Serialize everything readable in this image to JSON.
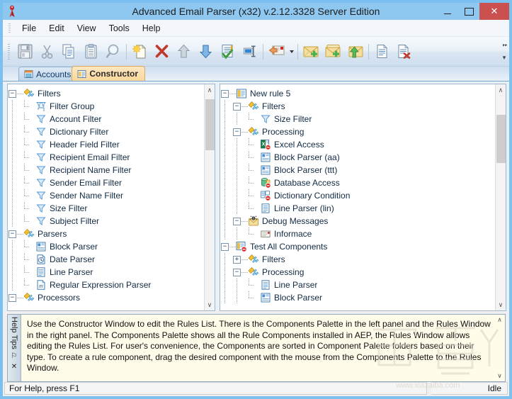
{
  "window": {
    "title": "Advanced Email Parser (x32) v.2.12.3328 Server Edition",
    "app_icon": "parser-app-icon",
    "minimize_label": "–",
    "maximize_label": "□",
    "close_label": "✕"
  },
  "menu": {
    "items": [
      {
        "label": "File"
      },
      {
        "label": "Edit"
      },
      {
        "label": "View"
      },
      {
        "label": "Tools"
      },
      {
        "label": "Help"
      }
    ]
  },
  "toolbar": {
    "buttons": [
      {
        "icon": "save-icon",
        "tooltip": "Save"
      },
      {
        "icon": "cut-icon",
        "tooltip": "Cut"
      },
      {
        "icon": "copy-icon",
        "tooltip": "Copy"
      },
      {
        "icon": "paste-icon",
        "tooltip": "Paste"
      },
      {
        "icon": "find-icon",
        "tooltip": "Find"
      },
      {
        "icon": "separator"
      },
      {
        "icon": "new-document-icon",
        "tooltip": "New"
      },
      {
        "icon": "delete-icon",
        "tooltip": "Delete"
      },
      {
        "icon": "move-up-icon",
        "tooltip": "Move Up"
      },
      {
        "icon": "move-down-icon",
        "tooltip": "Move Down"
      },
      {
        "icon": "test-document-icon",
        "tooltip": "Test"
      },
      {
        "icon": "rename-icon",
        "tooltip": "Rename"
      },
      {
        "icon": "separator"
      },
      {
        "icon": "reply-mail-icon",
        "tooltip": "Process Mail"
      },
      {
        "icon": "dropdown-caret"
      },
      {
        "icon": "separator"
      },
      {
        "icon": "add-mail-icon",
        "tooltip": "Add Message"
      },
      {
        "icon": "add-mail-folder-icon",
        "tooltip": "Add Messages Folder"
      },
      {
        "icon": "import-mail-icon",
        "tooltip": "Import Message"
      },
      {
        "icon": "separator"
      },
      {
        "icon": "document-icon",
        "tooltip": "View Log"
      },
      {
        "icon": "delete-document-icon",
        "tooltip": "Clear Log"
      }
    ],
    "overflow_label": "»"
  },
  "tabs": [
    {
      "label": "Accounts",
      "icon": "accounts-tab-icon",
      "active": false
    },
    {
      "label": "Constructor",
      "icon": "constructor-tab-icon",
      "active": true
    }
  ],
  "palette_tree": {
    "title": "Components Palette",
    "nodes": [
      {
        "depth": 0,
        "label": "Filters",
        "icon": "palette-folder-icon",
        "expander": "minus"
      },
      {
        "depth": 1,
        "label": "Filter Group",
        "icon": "filter-group-icon",
        "expander": "none"
      },
      {
        "depth": 1,
        "label": "Account Filter",
        "icon": "funnel-icon",
        "expander": "none"
      },
      {
        "depth": 1,
        "label": "Dictionary Filter",
        "icon": "funnel-icon",
        "expander": "none"
      },
      {
        "depth": 1,
        "label": "Header Field Filter",
        "icon": "funnel-icon",
        "expander": "none"
      },
      {
        "depth": 1,
        "label": "Recipient Email Filter",
        "icon": "funnel-icon",
        "expander": "none"
      },
      {
        "depth": 1,
        "label": "Recipient Name Filter",
        "icon": "funnel-icon",
        "expander": "none"
      },
      {
        "depth": 1,
        "label": "Sender Email Filter",
        "icon": "funnel-icon",
        "expander": "none"
      },
      {
        "depth": 1,
        "label": "Sender Name Filter",
        "icon": "funnel-icon",
        "expander": "none"
      },
      {
        "depth": 1,
        "label": "Size Filter",
        "icon": "funnel-icon",
        "expander": "none"
      },
      {
        "depth": 1,
        "label": "Subject Filter",
        "icon": "funnel-icon",
        "expander": "none"
      },
      {
        "depth": 0,
        "label": "Parsers",
        "icon": "palette-folder-icon",
        "expander": "minus"
      },
      {
        "depth": 1,
        "label": "Block Parser",
        "icon": "block-parser-icon",
        "expander": "none"
      },
      {
        "depth": 1,
        "label": "Date Parser",
        "icon": "date-parser-icon",
        "expander": "none"
      },
      {
        "depth": 1,
        "label": "Line Parser",
        "icon": "line-parser-icon",
        "expander": "none"
      },
      {
        "depth": 1,
        "label": "Regular Expression Parser",
        "icon": "regex-parser-icon",
        "expander": "none"
      },
      {
        "depth": 0,
        "label": "Processors",
        "icon": "palette-folder-icon",
        "expander": "minus"
      }
    ]
  },
  "rules_tree": {
    "title": "Rules Window",
    "nodes": [
      {
        "depth": 0,
        "label": "New rule 5",
        "icon": "rule-icon",
        "expander": "minus"
      },
      {
        "depth": 1,
        "label": "Filters",
        "icon": "palette-folder-icon",
        "expander": "minus"
      },
      {
        "depth": 2,
        "label": "Size Filter",
        "icon": "funnel-icon",
        "expander": "none"
      },
      {
        "depth": 1,
        "label": "Processing",
        "icon": "palette-folder-icon",
        "expander": "minus"
      },
      {
        "depth": 2,
        "label": "Excel Access",
        "icon": "excel-access-icon",
        "expander": "none"
      },
      {
        "depth": 2,
        "label": "Block Parser (aa)",
        "icon": "block-parser-icon",
        "expander": "none"
      },
      {
        "depth": 2,
        "label": "Block Parser (ttt)",
        "icon": "block-parser-icon",
        "expander": "none"
      },
      {
        "depth": 2,
        "label": "Database Access",
        "icon": "database-access-icon",
        "expander": "none"
      },
      {
        "depth": 2,
        "label": "Dictionary Condition",
        "icon": "dictionary-condition-icon",
        "expander": "none"
      },
      {
        "depth": 2,
        "label": "Line Parser (lin)",
        "icon": "line-parser-icon",
        "expander": "none"
      },
      {
        "depth": 1,
        "label": "Debug Messages",
        "icon": "debug-messages-icon",
        "expander": "minus"
      },
      {
        "depth": 2,
        "label": "Informace",
        "icon": "message-icon",
        "expander": "none"
      },
      {
        "depth": 0,
        "label": "Test All Components",
        "icon": "rule-disabled-icon",
        "expander": "minus"
      },
      {
        "depth": 1,
        "label": "Filters",
        "icon": "palette-folder-icon",
        "expander": "plus"
      },
      {
        "depth": 1,
        "label": "Processing",
        "icon": "palette-folder-icon",
        "expander": "minus"
      },
      {
        "depth": 2,
        "label": "Line Parser",
        "icon": "line-parser-icon",
        "expander": "none"
      },
      {
        "depth": 2,
        "label": "Block Parser",
        "icon": "block-parser-icon",
        "expander": "none"
      }
    ]
  },
  "help_tips": {
    "caption": "Help Tips",
    "pin_label": "⚐",
    "close_label": "✕",
    "text": "Use the Constructor Window to edit the Rules List. There is the Components Palette in the left panel and the Rules Window in the right panel. The Components Palette shows all the Rule Components installed in AEP, the Rules Window allows editing the Rules List. For user's convenience, the Components are sorted in Component Palette folders based on their type. To create a rule component, drag the desired component with the mouse from the Components Palette to the Rules Window.",
    "scroll_up": "∧",
    "scroll_down": "∨"
  },
  "status_bar": {
    "message": "For Help, press F1",
    "state": "Idle"
  },
  "scroll": {
    "up_arrow": "∧",
    "down_arrow": "∨"
  },
  "colors": {
    "titlebar": "#8ec7f0",
    "close_button": "#cb5151",
    "active_tab": "#fbd79a",
    "help_background": "#fffdea",
    "window_border": "#7cc0ef"
  }
}
